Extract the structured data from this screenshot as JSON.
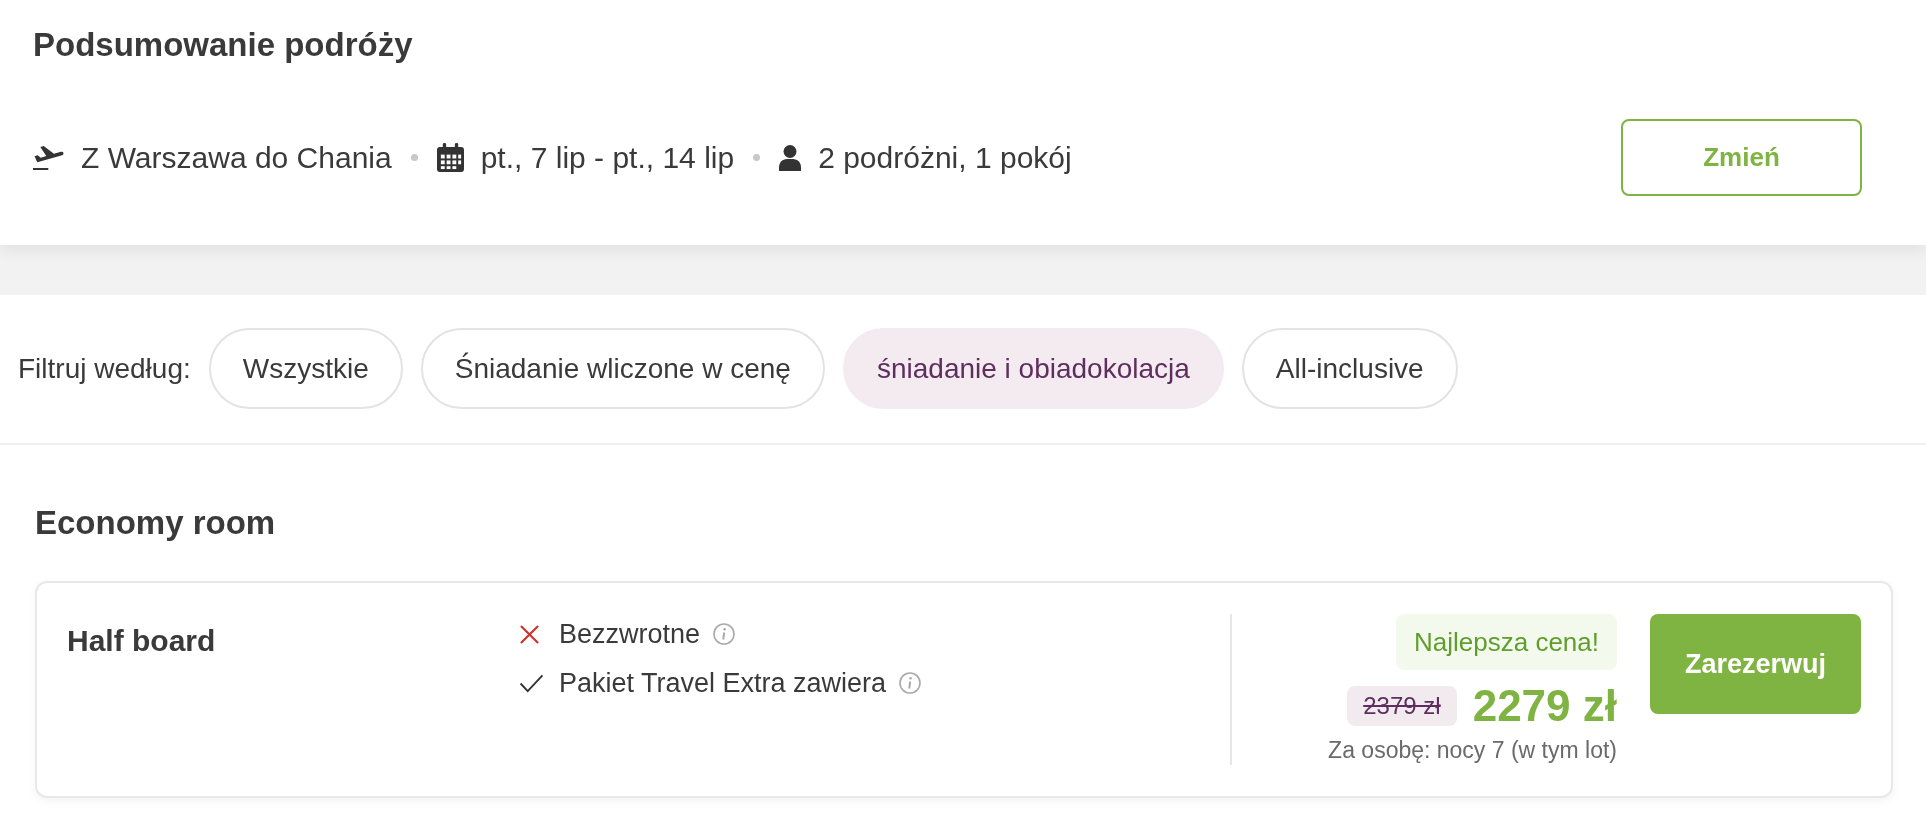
{
  "summary": {
    "title": "Podsumowanie podróży",
    "items": [
      {
        "kind": "flight",
        "text": "Z Warszawa do Chania"
      },
      {
        "kind": "dates",
        "text": "pt., 7 lip - pt., 14 lip"
      },
      {
        "kind": "travelers",
        "text": "2 podróżni, 1 pokój"
      }
    ],
    "change_button": "Zmień"
  },
  "filters": {
    "label": "Filtruj według:",
    "options": [
      {
        "label": "Wszystkie",
        "selected": false
      },
      {
        "label": "Śniadanie wliczone w cenę",
        "selected": false
      },
      {
        "label": "śniadanie i obiadokolacja",
        "selected": true
      },
      {
        "label": "All-inclusive",
        "selected": false
      }
    ]
  },
  "rooms": [
    {
      "title": "Economy room",
      "offers": [
        {
          "board": "Half board",
          "features": [
            {
              "kind": "excluded",
              "text": "Bezzwrotne",
              "info": true
            },
            {
              "kind": "included",
              "text": "Pakiet Travel Extra zawiera",
              "info": true
            }
          ],
          "badge": "Najlepsza cena!",
          "old_price": "2379 zł",
          "price": "2279 zł",
          "price_note": "Za osobę: nocy 7 (w tym lot)",
          "book_button": "Zarezerwuj"
        }
      ]
    }
  ]
}
